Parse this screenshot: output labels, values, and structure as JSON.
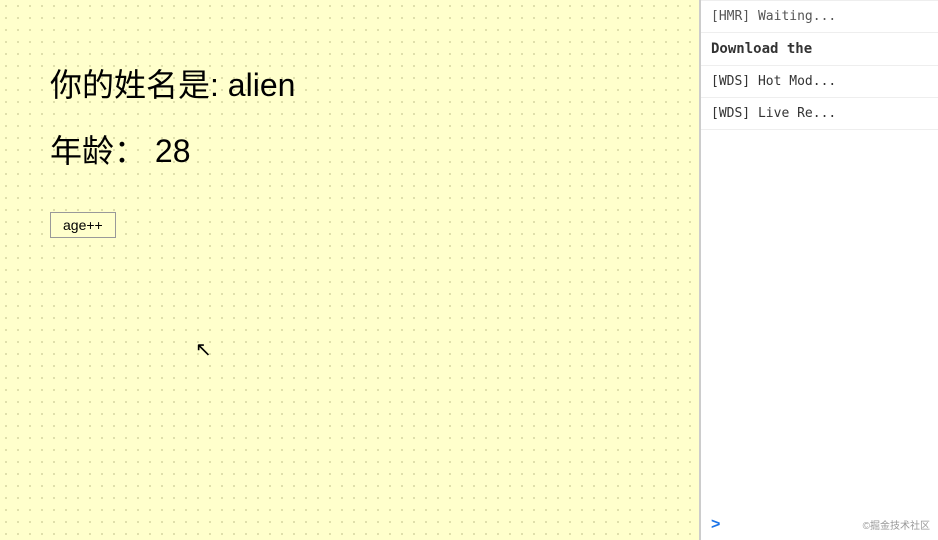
{
  "main": {
    "background_color": "#ffffcc",
    "name_label": "你的姓名是:",
    "name_value": "alien",
    "age_label": "年龄：",
    "age_value": "28",
    "button_label": "age++"
  },
  "sidebar": {
    "items": [
      {
        "text": "[HMR] Waiting...",
        "bold": false
      },
      {
        "text": "Download the",
        "bold": true
      },
      {
        "text": "[WDS] Hot Mod...",
        "bold": false
      },
      {
        "text": "[WDS] Live Re...",
        "bold": false
      }
    ],
    "chevron": ">",
    "footer": "©掘金技术社区"
  }
}
